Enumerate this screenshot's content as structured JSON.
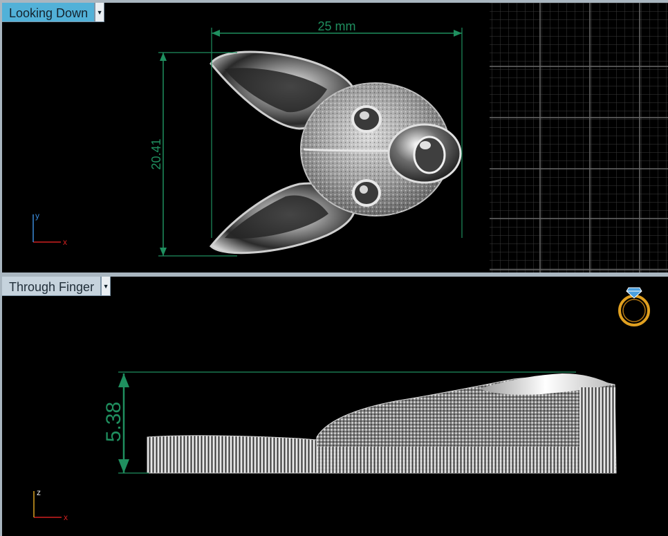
{
  "viewports": {
    "top": {
      "label": "Looking Down",
      "dimension_width": "25 mm",
      "dimension_height": "20.41",
      "axis_y": "y",
      "axis_x": "x"
    },
    "bottom": {
      "label": "Through Finger",
      "dimension_height": "5.38",
      "axis_z": "z",
      "axis_x": "x"
    }
  },
  "colors": {
    "dimension": "#1f8f5f",
    "axis_x": "#d02020",
    "axis_y": "#3a8ad8",
    "axis_z": "#d8a020",
    "active_tab": "#52b1d8",
    "inactive_tab": "#c6d3dd",
    "grid": "#5a5a5a"
  },
  "icons": {
    "ring": "ring-gem-icon",
    "dropdown": "chevron-down-icon"
  }
}
